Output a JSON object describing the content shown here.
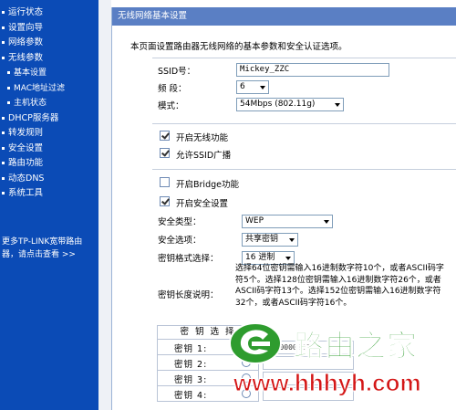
{
  "sidebar": {
    "items": [
      {
        "label": "运行状态",
        "level": "top"
      },
      {
        "label": "设置向导",
        "level": "top"
      },
      {
        "label": "网络参数",
        "level": "top"
      },
      {
        "label": "无线参数",
        "level": "top"
      },
      {
        "label": "基本设置",
        "level": "sub"
      },
      {
        "label": "MAC地址过滤",
        "level": "sub"
      },
      {
        "label": "主机状态",
        "level": "sub"
      },
      {
        "label": "DHCP服务器",
        "level": "top"
      },
      {
        "label": "转发规则",
        "level": "top"
      },
      {
        "label": "安全设置",
        "level": "top"
      },
      {
        "label": "路由功能",
        "level": "top"
      },
      {
        "label": "动态DNS",
        "level": "top"
      },
      {
        "label": "系统工具",
        "level": "top"
      }
    ],
    "promo_line1": "更多TP-LINK宽带路由",
    "promo_line2": "器，请点击查看 >>"
  },
  "panel": {
    "title": "无线网络基本设置",
    "description": "本页面设置路由器无线网络的基本参数和安全认证选项。"
  },
  "form": {
    "ssid_label": "SSID号：",
    "ssid_value": "Mickey_ZZC",
    "channel_label": "频  段：",
    "channel_value": "6",
    "mode_label": "模式：",
    "mode_value": "54Mbps (802.11g)",
    "enable_wireless_label": "开启无线功能",
    "enable_wireless_checked": true,
    "allow_ssid_broadcast_label": "允许SSID广播",
    "allow_ssid_broadcast_checked": true,
    "enable_bridge_label": "开启Bridge功能",
    "enable_bridge_checked": false,
    "enable_security_label": "开启安全设置",
    "enable_security_checked": true,
    "security_type_label": "安全类型：",
    "security_type_value": "WEP",
    "security_option_label": "安全选项：",
    "security_option_value": "共享密钥",
    "key_format_label": "密钥格式选择：",
    "key_format_value": "16 进制",
    "key_length_label": "密钥长度说明：",
    "key_length_help": "选择64位密钥需输入16进制数字符10个，或者ASCII码字符5个。选择128位密钥需输入16进制数字符26个，或者ASCII码字符13个。选择152位密钥需输入16进制数字符32个，或者ASCII码字符16个。"
  },
  "keys": {
    "header": "密 钥 选 择",
    "rows": [
      {
        "label": "密钥 1:",
        "selected": true,
        "value": "1000000000"
      },
      {
        "label": "密钥 2:",
        "selected": false,
        "value": ""
      },
      {
        "label": "密钥 3:",
        "selected": false,
        "value": ""
      },
      {
        "label": "密钥 4:",
        "selected": false,
        "value": ""
      }
    ]
  },
  "watermark": {
    "name": "路由之家",
    "url": "www.hhhyh.com"
  },
  "colors": {
    "sidebar_bg": "#0b4bb6",
    "panel_title_bg": "#5a7fc4",
    "watermark_green": "#2e9c2e",
    "watermark_red": "#d41717"
  }
}
